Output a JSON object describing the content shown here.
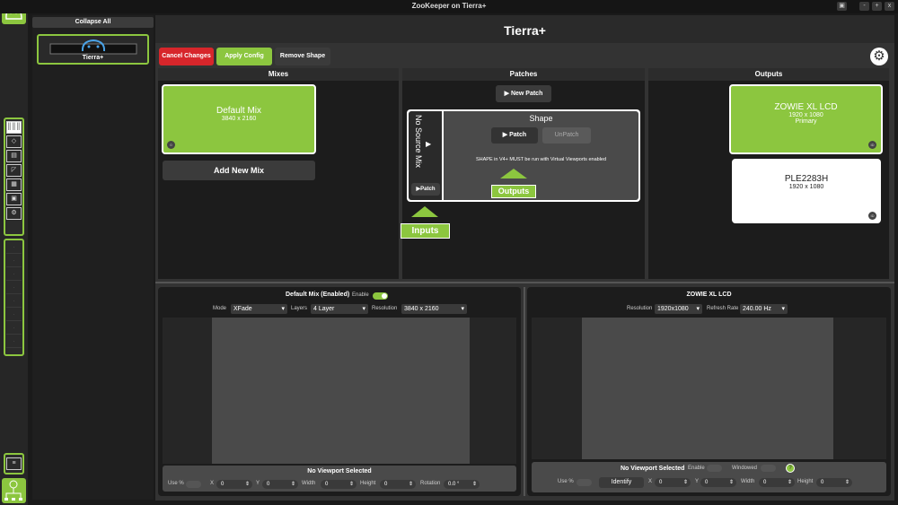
{
  "window": {
    "title": "ZooKeeper on Tierra+",
    "btn_screen": "▣",
    "btn_min": "-",
    "btn_max": "+",
    "btn_close": "x"
  },
  "nav": {
    "collapse_label": "Collapse All",
    "device_name": "Tierra+"
  },
  "header": {
    "title": "Tierra+"
  },
  "toolbar": {
    "cancel": "Cancel Changes",
    "apply": "Apply Config",
    "remove_shape": "Remove Shape"
  },
  "mixes": {
    "heading": "Mixes",
    "card_title": "Default Mix",
    "card_res": "3840 x 2160",
    "card_tag": "0",
    "add": "Add New Mix"
  },
  "patches": {
    "heading": "Patches",
    "new_patch": "New Patch",
    "source_label": "No Source Mix",
    "source_patch": "Patch",
    "shape_title": "Shape",
    "patch": "Patch",
    "unpatch": "UnPatch",
    "note": "SHAPE in V4+ MUST be run with Virtual Viewports enabled",
    "outputs_label": "Outputs",
    "inputs_label": "Inputs"
  },
  "outputs": {
    "heading": "Outputs",
    "items": [
      {
        "name": "ZOWIE XL LCD",
        "res": "1920 x 1080",
        "role": "Primary",
        "tag": "ID"
      },
      {
        "name": "PLE2283H",
        "res": "1920 x 1080",
        "tag": "ID"
      }
    ]
  },
  "mix_panel": {
    "title": "Default Mix (Enabled)",
    "enable": "Enable",
    "mode_label": "Mode",
    "mode": "XFade",
    "layers_label": "Layers",
    "layers": "4 Layer",
    "resolution_label": "Resolution",
    "resolution": "3840 x 2160",
    "no_viewport": "No Viewport Selected",
    "usepct": "Use %",
    "x": "X",
    "x_val": "0",
    "y": "Y",
    "y_val": "0",
    "width": "Width",
    "width_val": "0",
    "height": "Height",
    "height_val": "0",
    "rotation": "Rotation",
    "rotation_val": "0.0 °"
  },
  "out_panel": {
    "title": "ZOWIE XL LCD",
    "resolution_label": "Resolution",
    "resolution": "1920x1080",
    "refresh_label": "Refresh Rate",
    "refresh": "240.00 Hz",
    "no_viewport": "No Viewport Selected",
    "enable": "Enable",
    "windowed": "Windowed",
    "help": "?",
    "usepct": "Use %",
    "identify": "Identify",
    "x": "X",
    "x_val": "0",
    "y": "Y",
    "y_val": "0",
    "width": "Width",
    "width_val": "0",
    "height": "Height",
    "height_val": "0"
  },
  "colors": {
    "accent": "#8cc63f",
    "cancel": "#d7262b"
  }
}
